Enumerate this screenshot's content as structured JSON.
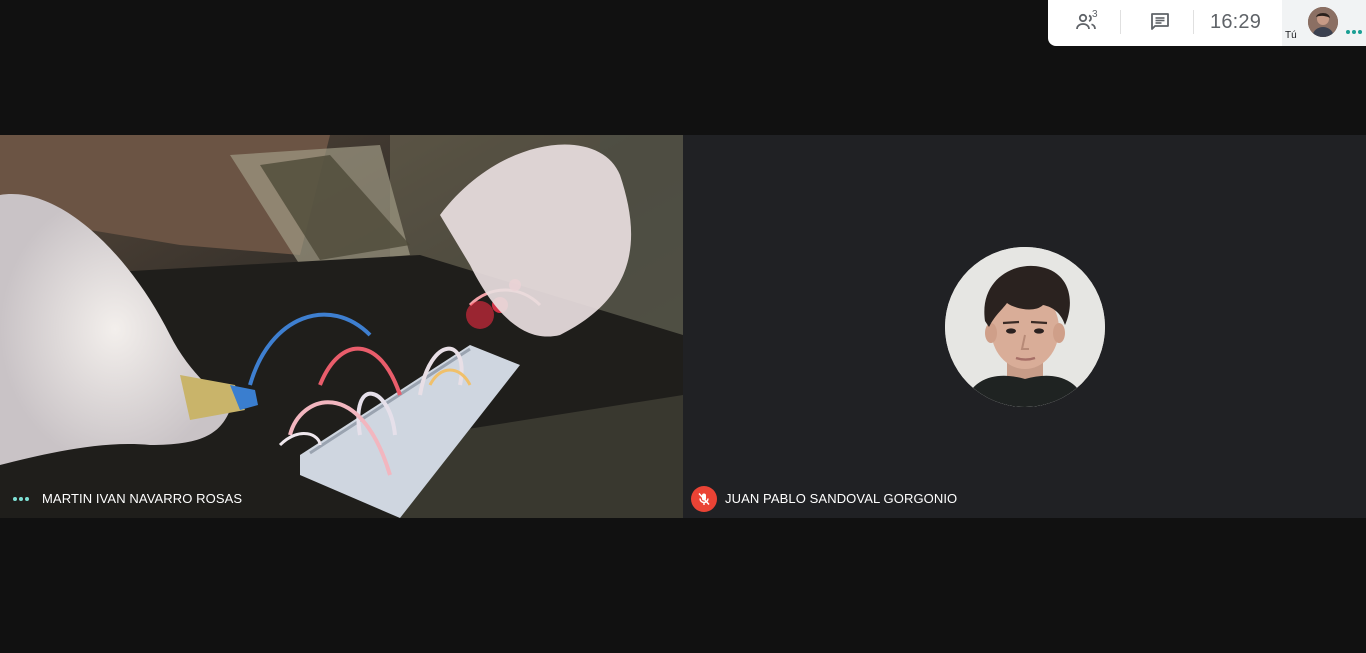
{
  "topbar": {
    "people_count": "3",
    "people_icon": "people-icon",
    "chat_icon": "chat-icon",
    "clock": "16:29",
    "self_label": "Tú",
    "self_dots_color": "#1a9f94"
  },
  "tiles": [
    {
      "name": "MARTIN IVAN NAVARRO ROSAS",
      "status_icon": "speaking-indicator-icon",
      "status_color": "#7ee0d5"
    },
    {
      "name": "JUAN PABLO SANDOVAL GORGONIO",
      "status_icon": "mic-off-icon",
      "status_color": "#ea4335"
    }
  ],
  "colors": {
    "background": "#111111",
    "tile_background": "#202124",
    "topbar_background": "#ffffff",
    "muted_red": "#ea4335"
  }
}
